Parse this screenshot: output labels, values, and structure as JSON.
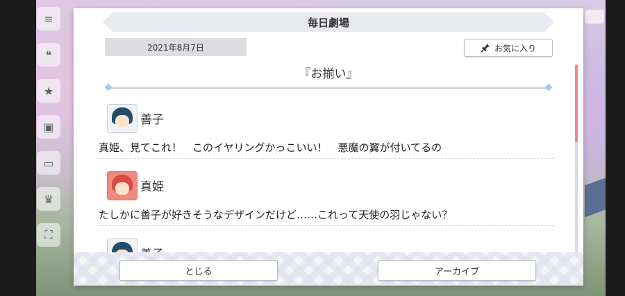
{
  "dialog": {
    "title": "毎日劇場",
    "date": "2021年8月7日",
    "favorite_label": "お気に入り",
    "episode_title": "『お揃い』"
  },
  "messages": [
    {
      "speaker": "善子",
      "text": "真姫、見てこれ！　このイヤリングかっこいい！　悪魔の翼が付いてるの",
      "avatar": "yoshiko"
    },
    {
      "speaker": "真姫",
      "text": "たしかに善子が好きそうなデザインだけど……これって天使の羽じゃない？",
      "avatar": "maki"
    },
    {
      "speaker": "善子",
      "text": "",
      "avatar": "yoshiko"
    }
  ],
  "footer": {
    "close_label": "とじる",
    "archive_label": "アーカイブ"
  },
  "colors": {
    "scroll_thumb": "#f0868b",
    "maki_avatar_bg": "#f28b7f",
    "yoshiko_hair": "#234e6a"
  },
  "icons": {
    "favorite": "pin-icon",
    "side_menu": [
      "menu-icon",
      "chat-icon",
      "event-icon",
      "gift-icon",
      "screen-icon",
      "cup-icon",
      "fullscreen-icon"
    ]
  }
}
